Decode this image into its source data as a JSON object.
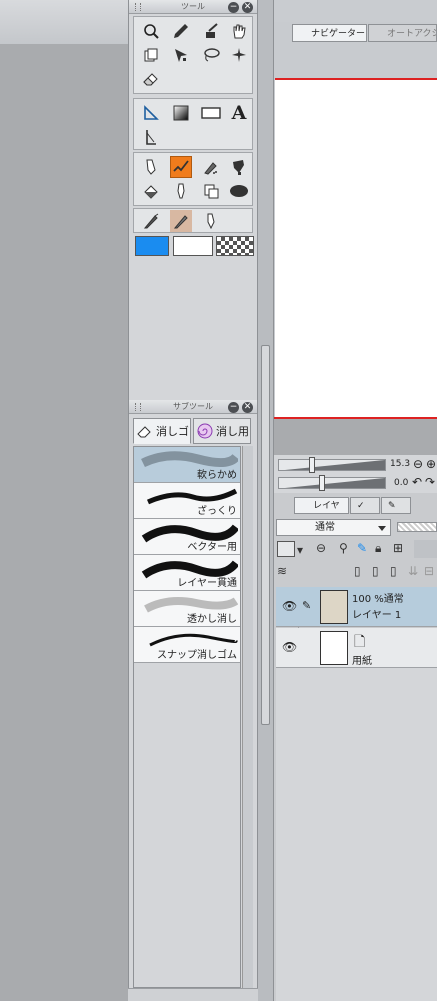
{
  "tool_panel": {
    "title": "ツール",
    "close_glyph": "✕",
    "min_glyph": "−",
    "tools_group1": [
      "magnifier-icon",
      "pen-icon",
      "eyedropper-icon",
      "hand-icon",
      "move-layer-icon",
      "object-select-icon",
      "lasso-icon",
      "auto-select-icon",
      "eraser-icon"
    ],
    "tools_group2": [
      "ruler-icon",
      "gradient-icon",
      "rectangle-icon",
      "text-icon",
      "frame-ruler-icon"
    ],
    "tools_group3_text": "A",
    "colors": {
      "main": "#1a8cf0",
      "sub": "#ffffff",
      "active": "#f07c1c"
    }
  },
  "sub_tool_panel": {
    "title": "サブツール",
    "tabs": [
      {
        "label": "消しゴ",
        "selected": true
      },
      {
        "label": "消し用",
        "selected": false
      }
    ],
    "brushes": [
      {
        "label": "軟らかめ",
        "selected": true
      },
      {
        "label": "ざっくり",
        "selected": false
      },
      {
        "label": "ベクター用",
        "selected": false
      },
      {
        "label": "レイヤー貫通",
        "selected": false
      },
      {
        "label": "透かし消し",
        "selected": false
      },
      {
        "label": "スナップ消しゴム",
        "selected": false
      }
    ]
  },
  "navigator": {
    "tabs": [
      {
        "label": "ナビゲーター",
        "selected": true
      },
      {
        "label": "オートアクシ",
        "selected": false
      }
    ],
    "zoom_value": "15.3",
    "rotate_value": "0.0"
  },
  "layer_panel": {
    "tabs": [
      {
        "label": "レイヤー",
        "selected": true
      }
    ],
    "blend_mode": "通常",
    "layers": [
      {
        "line1": "100 %通常",
        "line2": "レイヤー 1",
        "selected": true,
        "thumb_color": "#ddd6c6"
      },
      {
        "line1": "",
        "line2": "用紙",
        "selected": false,
        "thumb_color": "#ffffff"
      }
    ]
  }
}
